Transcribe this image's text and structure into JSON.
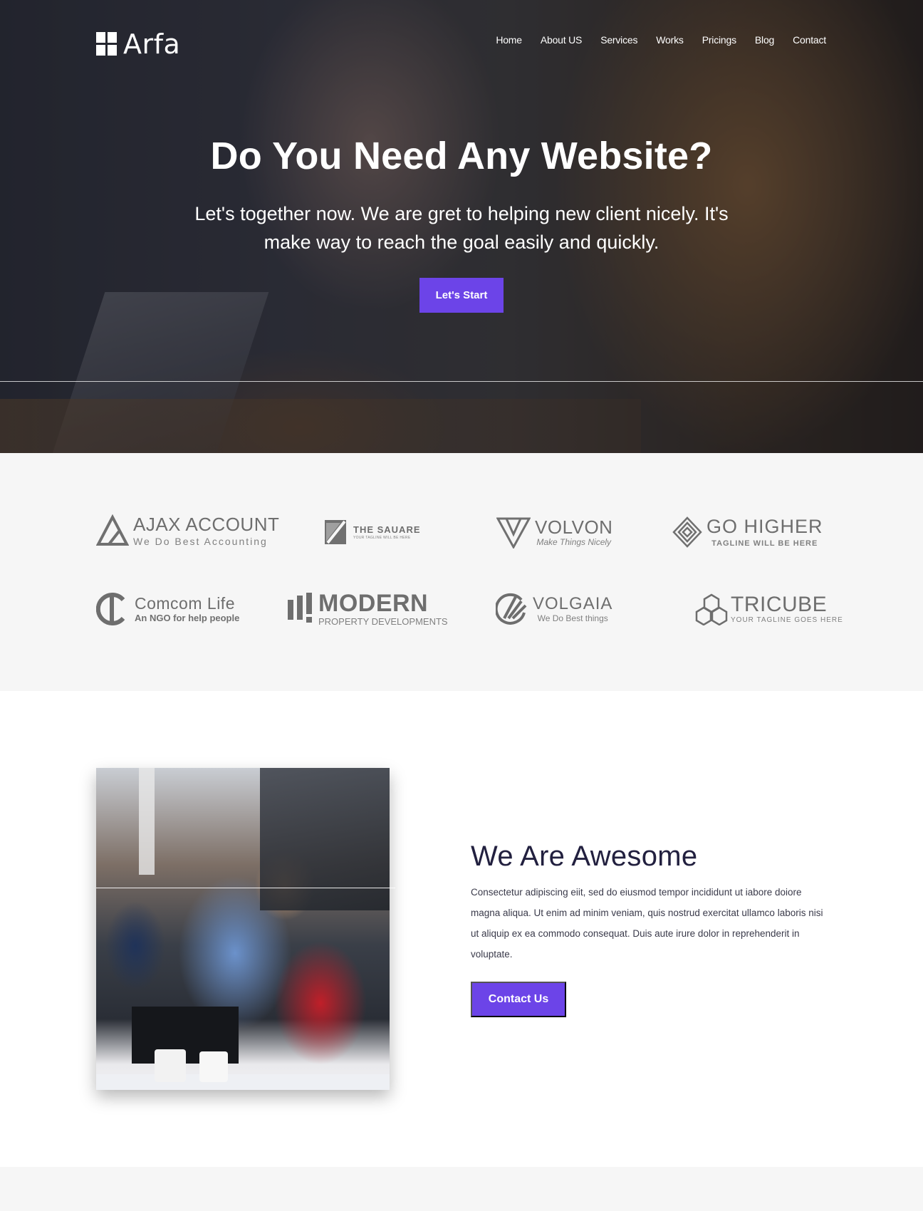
{
  "brand": {
    "name": "Arfa"
  },
  "nav": {
    "items": [
      "Home",
      "About US",
      "Services",
      "Works",
      "Pricings",
      "Blog",
      "Contact"
    ]
  },
  "hero": {
    "title": "Do You Need Any Website?",
    "subtitle": "Let's together now. We are gret to helping new client nicely. It's make way to reach the goal easily and quickly.",
    "cta": "Let's Start"
  },
  "clients": [
    {
      "name": "AJAX ACCOUNT",
      "tagline": "We Do Best Accounting"
    },
    {
      "name": "THE SAUARE",
      "tagline": "YOUR TAGLINE WILL BE HERE"
    },
    {
      "name": "VOLVON",
      "tagline": "Make Things Nicely"
    },
    {
      "name": "GO HIGHER",
      "tagline": "TAGLINE WILL BE HERE"
    },
    {
      "name": "Comcom Life",
      "tagline": "An NGO for help people"
    },
    {
      "name": "MODERN",
      "tagline": "PROPERTY DEVELOPMENTS"
    },
    {
      "name": "VOLGAIA",
      "tagline": "We Do Best things"
    },
    {
      "name": "TRICUBE",
      "tagline": "YOUR TAGLINE GOES HERE"
    }
  ],
  "about": {
    "title": "We Are Awesome",
    "text": "Consectetur adipiscing eiit, sed do eiusmod tempor incididunt ut iabore doiore magna aliqua. Ut enim ad minim veniam, quis nostrud exercitat ullamco laboris nisi ut aliquip ex ea commodo consequat. Duis aute irure dolor in reprehenderit in voluptate.",
    "cta": "Contact Us"
  },
  "colors": {
    "accent": "#6c44e8",
    "heading": "#22203f",
    "section_bg": "#f6f6f6"
  }
}
